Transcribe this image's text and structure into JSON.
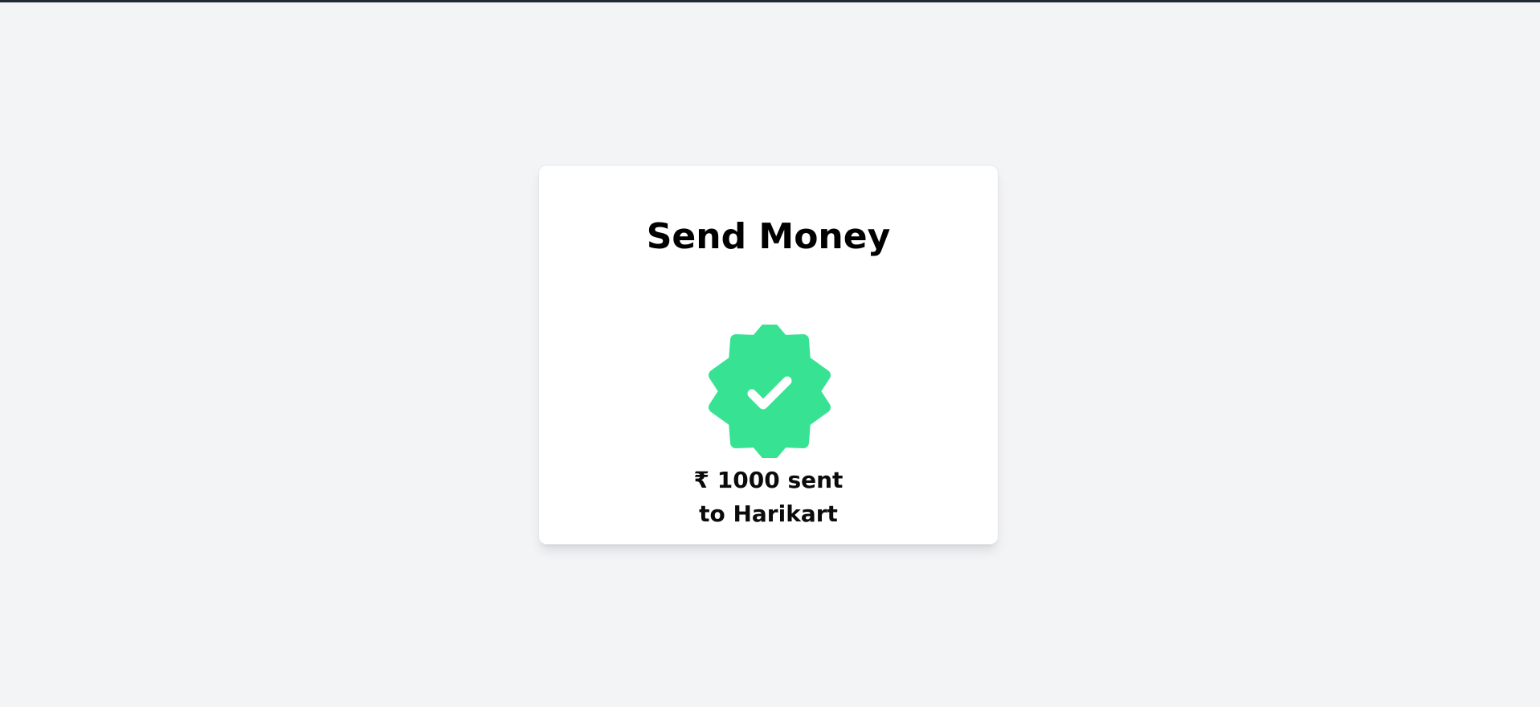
{
  "page": {
    "background": "#f3f4f6",
    "top_border_color": "#1f2937"
  },
  "card": {
    "title": "Send Money",
    "status_icon": "verified-badge-check-icon",
    "accent_color": "#37e392",
    "message_line1": "₹ 1000 sent",
    "message_line2": "to Harikart"
  }
}
